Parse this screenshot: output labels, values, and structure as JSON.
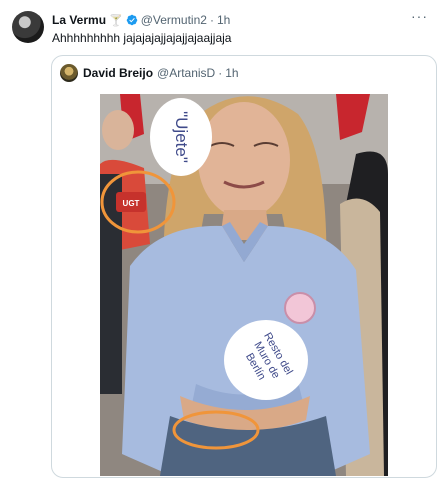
{
  "tweet": {
    "name": "La Vermu",
    "name_emoji": "🍸",
    "handle": "@Vermutin2",
    "time": "1h",
    "separator": "·",
    "text": "Ahhhhhhhhh jajajajajjajajjajaajjaja",
    "more": "···"
  },
  "quote": {
    "name": "David Breijo",
    "handle": "@ArtanisD",
    "time": "1h",
    "separator": "·",
    "photo": {
      "bubble1_text": "\"Ujete\"",
      "bubble2_text": "Resto del\nMuro de\nBerlín",
      "badge_text": "UGT",
      "colors": {
        "annotation": "#f0953a",
        "shirt": "#9fb5dc",
        "background": "#9a8f86"
      }
    }
  }
}
